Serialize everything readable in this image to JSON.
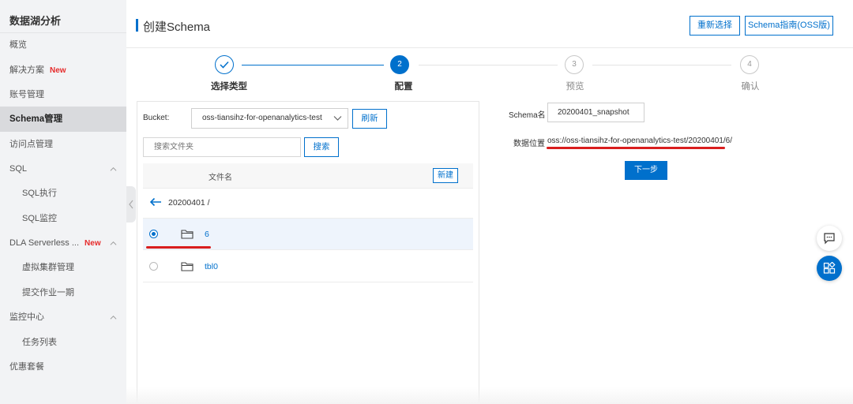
{
  "sidebar": {
    "title": "数据湖分析",
    "items": [
      {
        "label": "概览"
      },
      {
        "label": "解决方案",
        "badge": "New"
      },
      {
        "label": "账号管理"
      },
      {
        "label": "Schema管理",
        "active": true
      },
      {
        "label": "访问点管理"
      },
      {
        "label": "SQL",
        "expanded": true
      },
      {
        "label": "SQL执行"
      },
      {
        "label": "SQL监控"
      },
      {
        "label": "DLA Serverless ...",
        "badge": "New",
        "expanded": true
      },
      {
        "label": "虚拟集群管理"
      },
      {
        "label": "提交作业一期"
      },
      {
        "label": "监控中心",
        "expanded": true
      },
      {
        "label": "任务列表"
      },
      {
        "label": "优惠套餐"
      }
    ]
  },
  "header": {
    "title": "创建Schema",
    "reselect_label": "重新选择",
    "guide_label": "Schema指南(OSS版)"
  },
  "steps": [
    {
      "number": "",
      "label": "选择类型",
      "state": "done"
    },
    {
      "number": "2",
      "label": "配置",
      "state": "active"
    },
    {
      "number": "3",
      "label": "预览",
      "state": "pending"
    },
    {
      "number": "4",
      "label": "确认",
      "state": "pending"
    }
  ],
  "left_panel": {
    "bucket_label": "Bucket:",
    "bucket_value": "oss-tiansihz-for-openanalytics-test",
    "refresh_label": "刷新",
    "search_placeholder": "搜索文件夹",
    "search_button": "搜索",
    "column_filename": "文件名",
    "new_button": "新建",
    "current_path": "20200401 /",
    "files": [
      {
        "name": "6",
        "selected": true
      },
      {
        "name": "tbl0",
        "selected": false
      }
    ]
  },
  "right_panel": {
    "schema_name_label": "Schema名",
    "schema_name_value": "20200401_snapshot",
    "data_location_label": "数据位置",
    "data_location_value": "oss://oss-tiansihz-for-openanalytics-test/20200401/6/",
    "next_button": "下一步"
  },
  "colors": {
    "accent": "#0070cc",
    "brand_orange": "#ff6a00",
    "badge_red": "#e62b2b",
    "annotation_red": "#d91e1e"
  },
  "icons": {
    "back": "arrow-left-icon",
    "folder": "folder-icon",
    "dropdown": "chevron-down-icon",
    "chat": "chat-icon",
    "apps": "apps-icon",
    "check": "check-icon"
  }
}
